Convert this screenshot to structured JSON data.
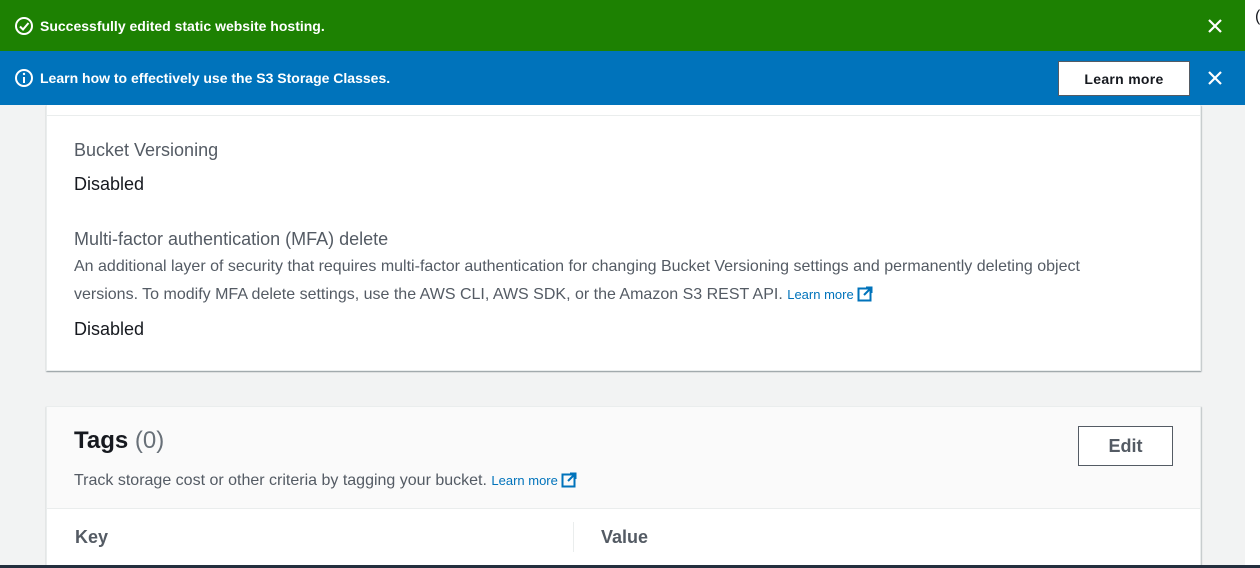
{
  "success_flash": {
    "message": "Successfully edited static website hosting.",
    "icon": "check-circle-icon",
    "color": "#1d8102"
  },
  "info_flash": {
    "message": "Learn how to effectively use the S3 Storage Classes.",
    "icon": "info-circle-icon",
    "button_label": "Learn more",
    "color": "#0073bb"
  },
  "versioning": {
    "bucket_versioning_label": "Bucket Versioning",
    "bucket_versioning_value": "Disabled",
    "mfa_label": "Multi-factor authentication (MFA) delete",
    "mfa_description_line1": "An additional layer of security that requires multi-factor authentication for changing Bucket Versioning settings and permanently deleting object",
    "mfa_description_line2": "versions. To modify MFA delete settings, use the AWS CLI, AWS SDK, or the Amazon S3 REST API.",
    "mfa_learn_more": "Learn more",
    "mfa_value": "Disabled"
  },
  "tags": {
    "title": "Tags",
    "count": "(0)",
    "description": "Track storage cost or other criteria by tagging your bucket.",
    "learn_more": "Learn more",
    "edit_label": "Edit",
    "columns": [
      "Key",
      "Value"
    ]
  },
  "colors": {
    "link": "#0073bb",
    "text_secondary": "#545b64"
  }
}
